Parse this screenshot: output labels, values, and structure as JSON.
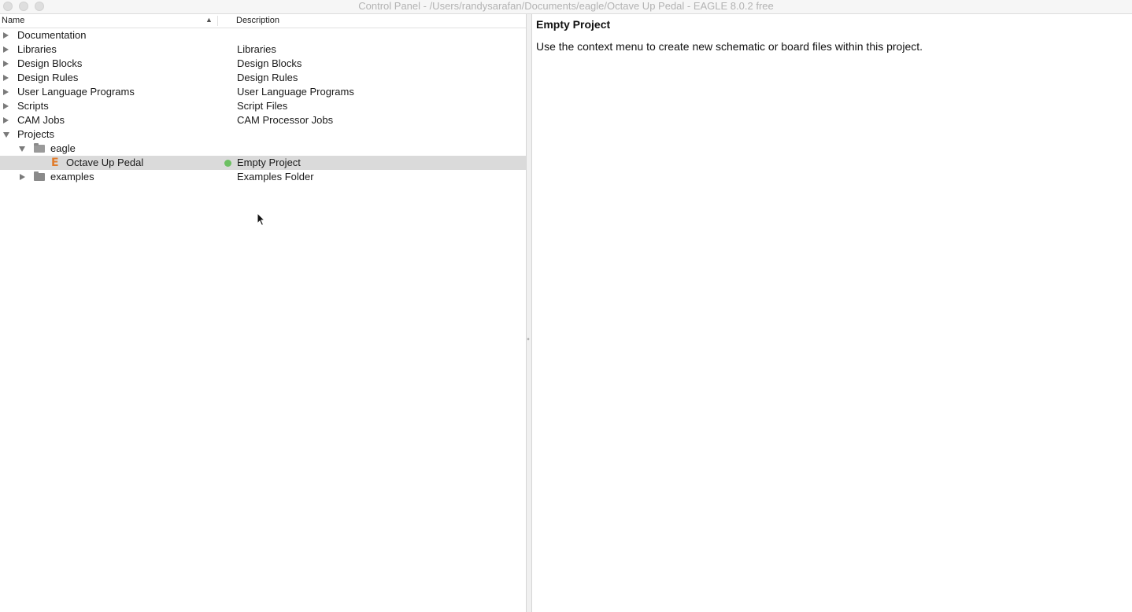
{
  "window": {
    "title": "Control Panel - /Users/randysarafan/Documents/eagle/Octave Up Pedal - EAGLE 8.0.2 free"
  },
  "columns": {
    "name": "Name",
    "sort_indicator": "▲",
    "description": "Description"
  },
  "tree": [
    {
      "label": "Documentation",
      "desc": ""
    },
    {
      "label": "Libraries",
      "desc": "Libraries"
    },
    {
      "label": "Design Blocks",
      "desc": "Design Blocks"
    },
    {
      "label": "Design Rules",
      "desc": "Design Rules"
    },
    {
      "label": "User Language Programs",
      "desc": "User Language Programs"
    },
    {
      "label": "Scripts",
      "desc": "Script Files"
    },
    {
      "label": "CAM Jobs",
      "desc": "CAM Processor Jobs"
    },
    {
      "label": "Projects",
      "desc": ""
    },
    {
      "label": "eagle",
      "desc": ""
    },
    {
      "label": "Octave Up Pedal",
      "desc": "Empty Project"
    },
    {
      "label": "examples",
      "desc": "Examples Folder"
    }
  ],
  "icons": {
    "eagle_project": "eagle-project-icon",
    "folder": "folder-icon",
    "status": "active-status-dot"
  },
  "colors": {
    "status_active": "#6cc062",
    "eagle_icon": "#e07b2a",
    "selection": "#dadada"
  },
  "detail": {
    "title": "Empty Project",
    "body": "Use the context menu to create new schematic or board files within this project."
  }
}
